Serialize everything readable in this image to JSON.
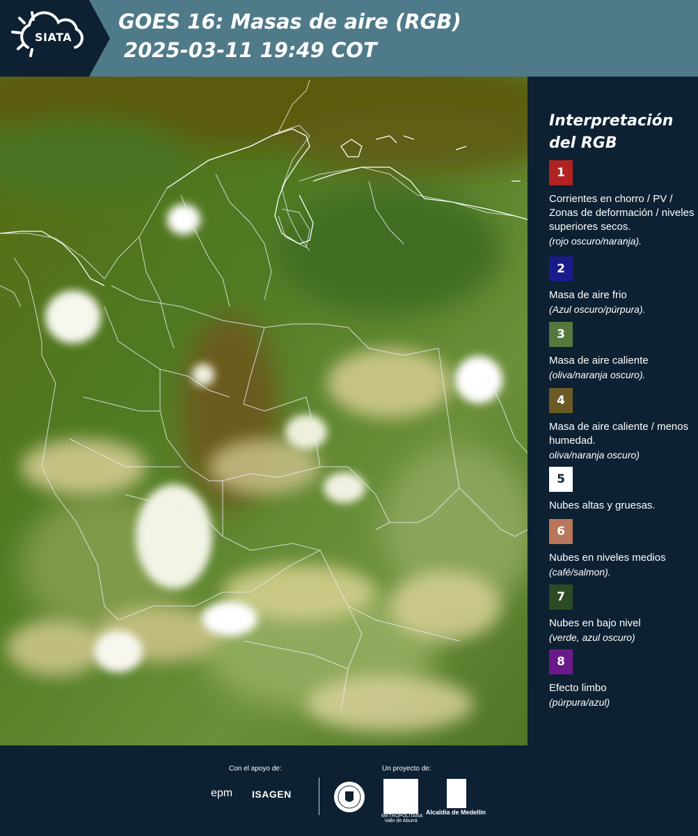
{
  "header": {
    "logo_text": "SIATA",
    "title_line1": "GOES 16: Masas de aire (RGB)",
    "title_line2": "2025-03-11 19:49 COT"
  },
  "legend": {
    "title": "Interpretación del RGB",
    "items": [
      {
        "number": "1",
        "color": "#b22222",
        "desc": "Corrientes en chorro / PV / Zonas de deformación / niveles superiores secos.",
        "note": "(rojo oscuro/naranja)."
      },
      {
        "number": "2",
        "color": "#1a1a8c",
        "desc": "Masa de aire frio",
        "note": "(Azul oscuro/púrpura)."
      },
      {
        "number": "3",
        "color": "#58773d",
        "desc": "Masa de aire caliente",
        "note": "(oliva/naranja oscuro)."
      },
      {
        "number": "4",
        "color": "#6b5a26",
        "desc": "Masa de aire caliente / menos humedad.",
        "note": "oliva/naranja oscuro)"
      },
      {
        "number": "5",
        "color": "#ffffff",
        "desc": "Nubes altas y gruesas.",
        "note": ""
      },
      {
        "number": "6",
        "color": "#b8765a",
        "desc": "Nubes en niveles medios",
        "note": "(café/salmon)."
      },
      {
        "number": "7",
        "color": "#2d4a22",
        "desc": "Nubes en bajo nivel",
        "note": "(verde, azul oscuro)"
      },
      {
        "number": "8",
        "color": "#6a1a8a",
        "desc": "Efecto limbo",
        "note": "(púrpura/azul)"
      }
    ]
  },
  "footer": {
    "support_label": "Con el apoyo de:",
    "project_label": "Un proyecto de:",
    "epm": "epm",
    "isagen": "ISAGEN",
    "area_text": "METROPOLITANA Valle de Aburrá",
    "alcaldia": "Alcaldía de Medellín"
  }
}
